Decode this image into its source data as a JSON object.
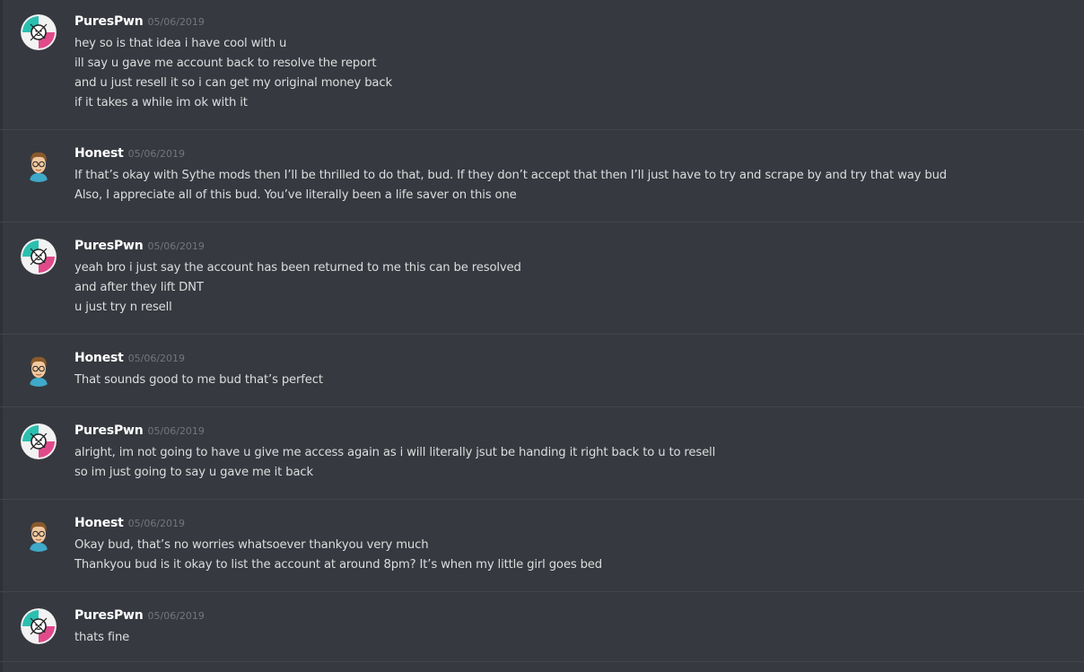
{
  "messages": [
    {
      "author": "PuresPwn",
      "avatar_icon": "blink-182-smiley-avatar-icon",
      "timestamp": "05/06/2019",
      "lines": [
        "hey so is that idea i have cool with u",
        "ill say u gave me account back to resolve the report",
        "and u just resell it so i can get my original money back",
        "if it takes a while im ok with it"
      ]
    },
    {
      "author": "Honest",
      "avatar_icon": "cartoon-boy-glasses-avatar-icon",
      "timestamp": "05/06/2019",
      "lines": [
        "If that’s okay with Sythe mods then I’ll be thrilled to do that, bud. If they don’t accept that then I’ll just have to try and scrape by and try that way bud",
        "Also, I appreciate all of this bud. You’ve literally been a life saver on this one"
      ]
    },
    {
      "author": "PuresPwn",
      "avatar_icon": "blink-182-smiley-avatar-icon",
      "timestamp": "05/06/2019",
      "lines": [
        "yeah bro i just say the account has been returned to me this can be resolved",
        "and after they lift DNT",
        "u just try n resell"
      ]
    },
    {
      "author": "Honest",
      "avatar_icon": "cartoon-boy-glasses-avatar-icon",
      "timestamp": "05/06/2019",
      "lines": [
        "That sounds good to me bud that’s perfect"
      ]
    },
    {
      "author": "PuresPwn",
      "avatar_icon": "blink-182-smiley-avatar-icon",
      "timestamp": "05/06/2019",
      "lines": [
        "alright, im not going to have u give me access again as i will literally jsut be handing it right back to u to resell",
        "so im just going to say u gave me it back"
      ]
    },
    {
      "author": "Honest",
      "avatar_icon": "cartoon-boy-glasses-avatar-icon",
      "timestamp": "05/06/2019",
      "lines": [
        "Okay bud, that’s no worries whatsoever thankyou very much",
        "Thankyou bud is it okay to list the account at around 8pm? It’s when my little girl goes bed"
      ]
    },
    {
      "author": "PuresPwn",
      "avatar_icon": "blink-182-smiley-avatar-icon",
      "timestamp": "05/06/2019",
      "lines": [
        "thats fine"
      ]
    }
  ]
}
